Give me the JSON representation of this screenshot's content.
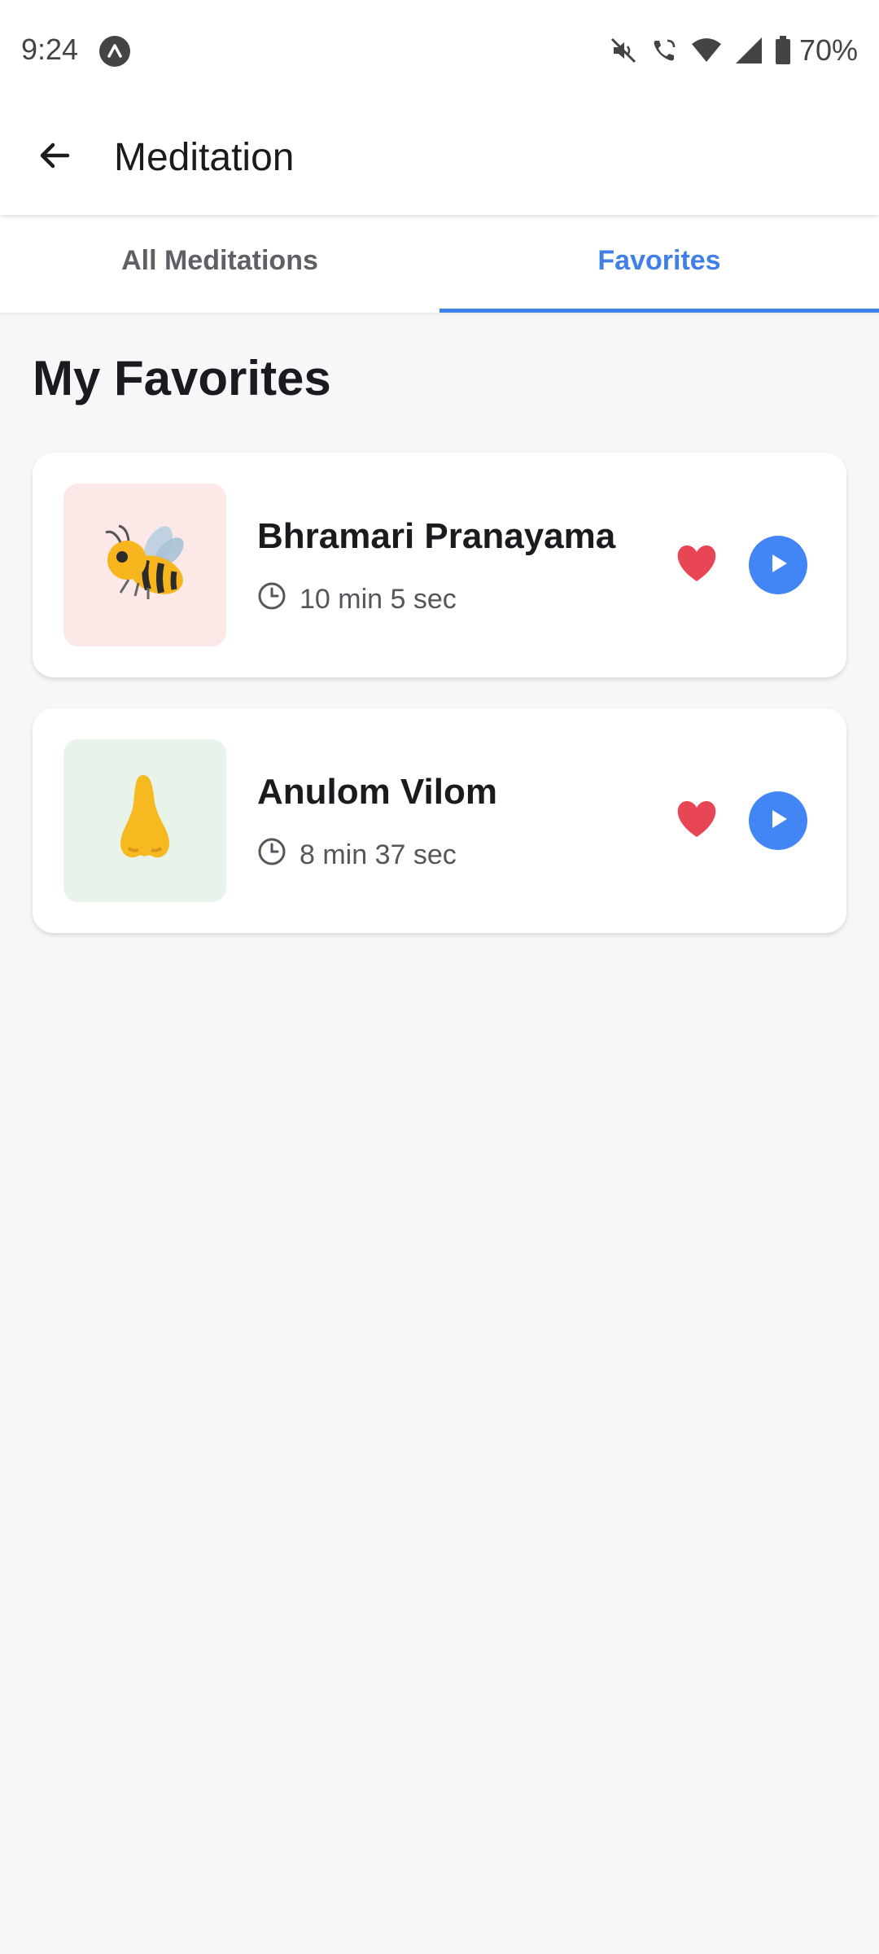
{
  "status_bar": {
    "time": "9:24",
    "battery": "70%",
    "icons": [
      "app-notification-icon",
      "mute-icon",
      "wifi-call-icon",
      "wifi-icon",
      "signal-icon",
      "battery-icon"
    ]
  },
  "app_bar": {
    "title": "Meditation",
    "back_icon": "arrow-back-icon"
  },
  "tabs": [
    {
      "label": "All Meditations",
      "active": false
    },
    {
      "label": "Favorites",
      "active": true
    }
  ],
  "section": {
    "title": "My Favorites"
  },
  "favorites": [
    {
      "title": "Bhramari Pranayama",
      "duration": "10 min 5 sec",
      "icon": "bee-icon",
      "thumb_color": "#fce8e6",
      "favorited": true
    },
    {
      "title": "Anulom Vilom",
      "duration": "8 min 37 sec",
      "icon": "nose-icon",
      "thumb_color": "#e8f3e9",
      "favorited": true
    }
  ],
  "colors": {
    "accent": "#3f7fe6",
    "heart": "#e84555",
    "play": "#4285f4",
    "background": "#f6f7f9"
  }
}
